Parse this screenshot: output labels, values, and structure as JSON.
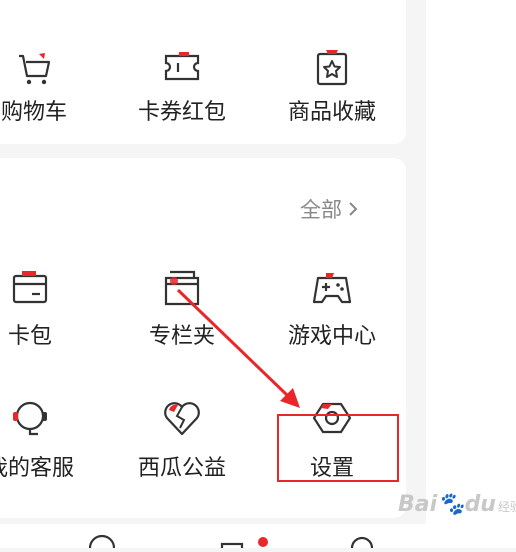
{
  "orders_card": {
    "items": [
      {
        "label": "购物车",
        "icon": "cart-icon"
      },
      {
        "label": "卡券红包",
        "icon": "ticket-icon"
      },
      {
        "label": "商品收藏",
        "icon": "favorite-bag-icon"
      }
    ]
  },
  "services_card": {
    "all_label": "全部",
    "items": [
      {
        "label": "卡包",
        "icon": "card-wallet-icon"
      },
      {
        "label": "专栏夹",
        "icon": "folder-icon"
      },
      {
        "label": "游戏中心",
        "icon": "gamepad-icon"
      },
      {
        "label": "我的客服",
        "icon": "headset-icon"
      },
      {
        "label": "西瓜公益",
        "icon": "heart-icon"
      },
      {
        "label": "设置",
        "icon": "settings-hexagon-icon"
      }
    ]
  },
  "watermark": {
    "brand": "Bai",
    "paw": "du",
    "suffix": "经验"
  },
  "colors": {
    "accent": "#e8272b",
    "text": "#222222",
    "muted": "#888888",
    "icon_stroke": "#333333"
  }
}
